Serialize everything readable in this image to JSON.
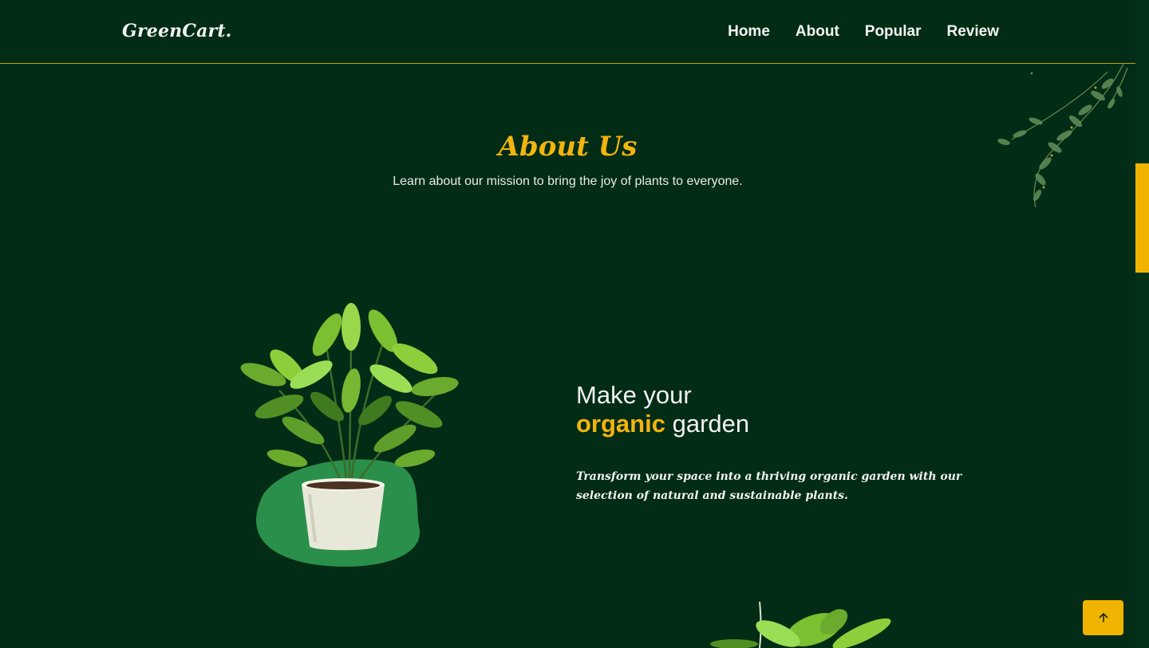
{
  "brand": {
    "logo_text": "GreenCart."
  },
  "nav": {
    "items": [
      {
        "label": "Home"
      },
      {
        "label": "About"
      },
      {
        "label": "Popular"
      },
      {
        "label": "Review"
      }
    ]
  },
  "about": {
    "title": "About Us",
    "subtitle": "Learn about our mission to bring the joy of plants to everyone.",
    "headline_line1": "Make your",
    "headline_accent": "organic",
    "headline_rest": "garden",
    "description": "Transform your space into a thriving organic garden with our selection of natural and sustainable plants."
  },
  "colors": {
    "background": "#022c15",
    "accent": "#f2b40e",
    "blob": "#2a8f4a"
  },
  "icons": {
    "back_to_top": "arrow-up-icon",
    "plant": "potted-plant-icon",
    "vine": "hanging-vine-icon"
  }
}
